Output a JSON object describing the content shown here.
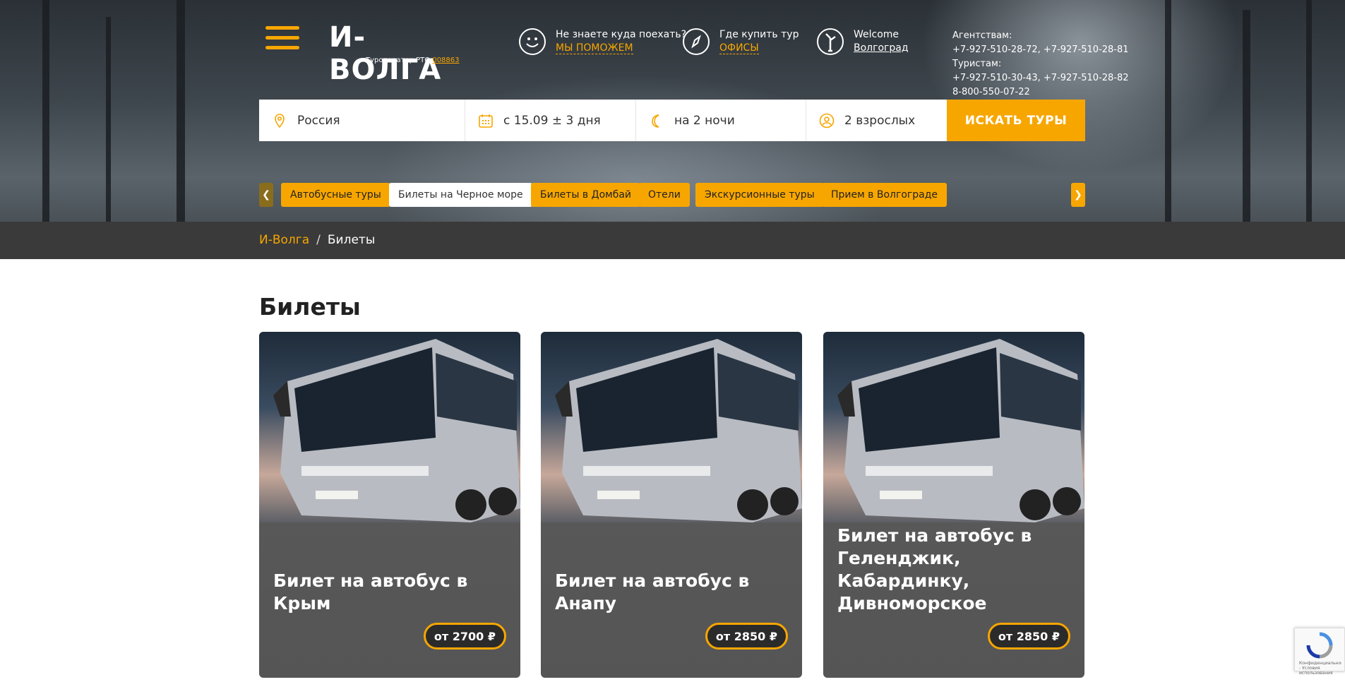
{
  "header": {
    "logo_text": "И-ВОЛГА",
    "logo_sub_prefix": "Туроператор РТО",
    "logo_sub_link": "008863",
    "help": {
      "question": "Не знаете куда поехать?",
      "link": "МЫ ПОМОЖЕМ",
      "icon": "smile-icon"
    },
    "offices": {
      "question": "Где купить тур",
      "link": "ОФИСЫ",
      "icon": "compass-icon"
    },
    "city": {
      "welcome": "Welcome",
      "link": "Волгоград",
      "icon": "monument-icon"
    },
    "contacts": {
      "agents_label": "Агентствам:",
      "agents_phones": "+7-927-510-28-72, +7-927-510-28-81",
      "tourists_label": "Туристам:",
      "tourists_phones": "+7-927-510-30-43, +7-927-510-28-82",
      "hotline": "8-800-550-07-22"
    }
  },
  "search": {
    "destination": "Россия",
    "dates": "с 15.09 ± 3 дня",
    "nights": "на 2 ночи",
    "guests": "2 взрослых",
    "button": "ИСКАТЬ ТУРЫ"
  },
  "tags": [
    {
      "label": "Автобусные туры",
      "active": false
    },
    {
      "label": "Билеты на Черное море",
      "active": true
    },
    {
      "label": "Билеты в Домбай",
      "active": false
    },
    {
      "label": "Отели",
      "active": false
    },
    {
      "label": "Экскурсионные туры",
      "active": false
    },
    {
      "label": "Прием в Волгограде",
      "active": false
    }
  ],
  "breadcrumb": {
    "home": "И-Волга",
    "separator": "/",
    "current": "Билеты"
  },
  "page_title": "Билеты",
  "cards": [
    {
      "title": "Билет на автобус в Крым",
      "price": "от 2700 ₽"
    },
    {
      "title": "Билет на автобус в Анапу",
      "price": "от 2850 ₽"
    },
    {
      "title": "Билет на автобус в Геленджик, Кабардинку, Дивноморское",
      "price": "от 2850 ₽"
    }
  ],
  "recaptcha": {
    "text": "Конфиденциальность - Условия использования"
  },
  "colors": {
    "accent": "#f7a600",
    "dark_bar": "#3a3a3a",
    "card_bg": "#555555"
  }
}
